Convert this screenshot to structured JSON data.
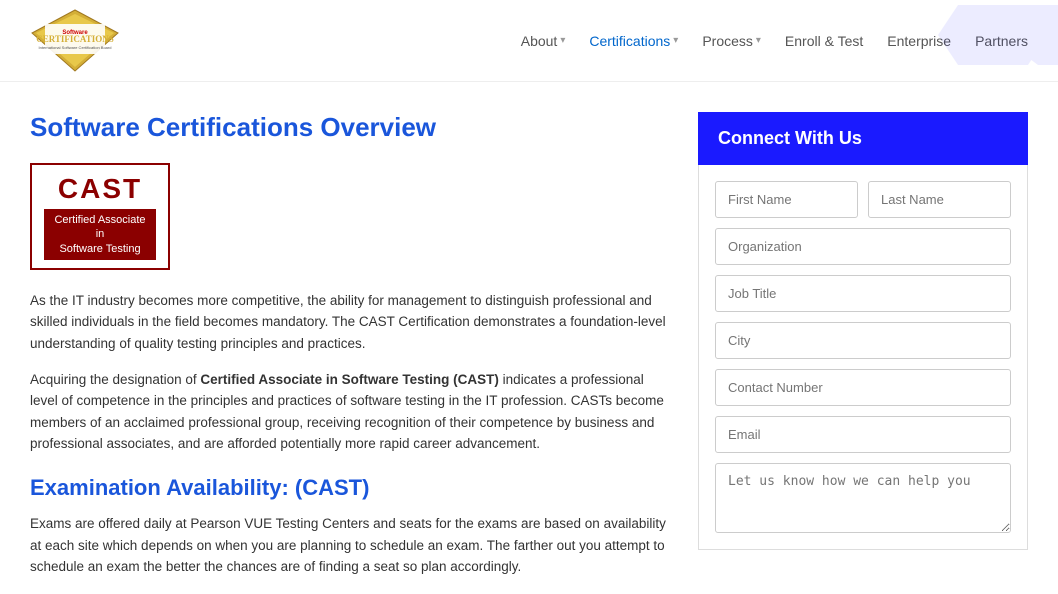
{
  "header": {
    "logo_text": "CERTIFICATIONS",
    "logo_sub": "International Software Certification Board"
  },
  "nav": {
    "items": [
      {
        "label": "About",
        "has_dropdown": true,
        "active": false
      },
      {
        "label": "Certifications",
        "has_dropdown": true,
        "active": true
      },
      {
        "label": "Process",
        "has_dropdown": true,
        "active": false
      },
      {
        "label": "Enroll & Test",
        "has_dropdown": false,
        "active": false
      },
      {
        "label": "Enterprise",
        "has_dropdown": false,
        "active": false
      },
      {
        "label": "Partners",
        "has_dropdown": false,
        "active": false
      }
    ]
  },
  "main": {
    "page_title": "Software Certifications Overview",
    "cast_logo": {
      "title": "CAST",
      "subtitle": "Certified Associate in\nSoftware Testing"
    },
    "paragraph1": "As the IT industry becomes more competitive, the ability for management to distinguish professional and skilled individuals in the field becomes mandatory. The CAST Certification demonstrates a foundation-level understanding of quality testing principles and practices.",
    "paragraph2_prefix": "Acquiring the designation of ",
    "paragraph2_bold": "Certified Associate in Software Testing (CAST)",
    "paragraph2_suffix": " indicates a professional level of competence in the principles and practices of software testing in the IT profession. CASTs become members of an acclaimed professional group, receiving recognition of their competence by business and professional associates, and are afforded potentially more rapid career advancement.",
    "section_title": "Examination Availability: (CAST)",
    "paragraph3": "Exams are offered daily at Pearson VUE Testing Centers and seats for the exams are based on availability at each site which depends on when you are planning to schedule an exam. The farther out you attempt to schedule an exam the better the chances are of finding a seat so plan accordingly."
  },
  "form": {
    "connect_title": "Connect With Us",
    "first_name_placeholder": "First Name",
    "last_name_placeholder": "Last Name",
    "organization_placeholder": "Organization",
    "job_title_placeholder": "Job Title",
    "city_placeholder": "City",
    "contact_number_placeholder": "Contact Number",
    "email_placeholder": "Email",
    "message_placeholder": "Let us know how we can help you"
  }
}
